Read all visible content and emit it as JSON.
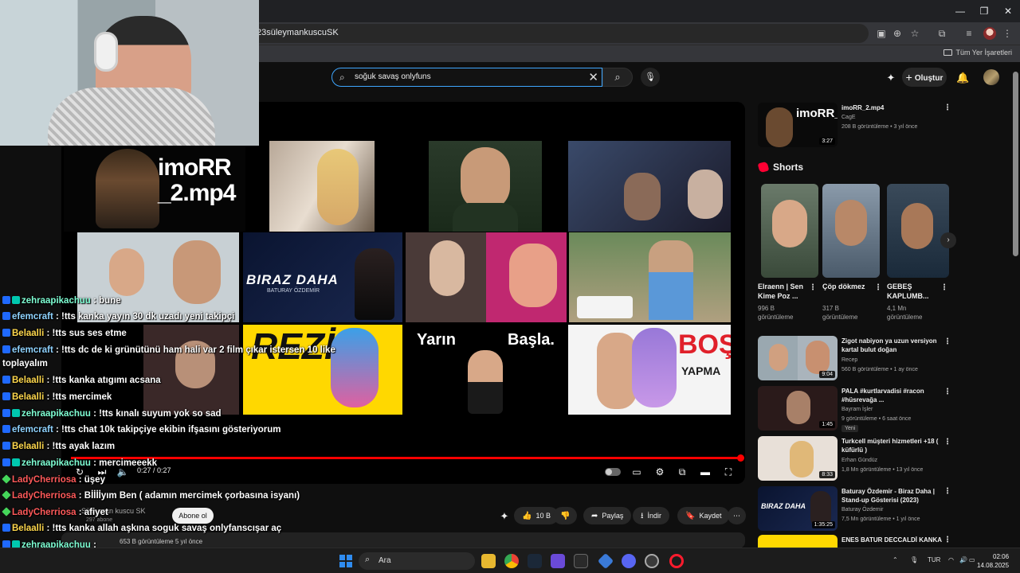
{
  "browser": {
    "url": "23süleymankuscuSK",
    "bookmarks_folder": "Tüm Yer İşaretleri",
    "window_controls": {
      "minimize": "—",
      "restore": "❐",
      "close": "✕"
    }
  },
  "header": {
    "search_query": "soğuk savaş onlyfuns",
    "create_label": "Oluştur"
  },
  "player": {
    "thumb_imorr": "imoRR\n_2.mp4",
    "thumb_biraz": "BIRAZ DAHA",
    "thumb_biraz_sub": "BATURAY ÖZDEMİR",
    "thumb_yarin": "Yarın",
    "thumb_basla": "Başla.",
    "thumb_bos": "BOŞ",
    "thumb_yapma": "YAPMA",
    "thumb_rezil": "REZİL",
    "time": "0:27 / 0:27",
    "progress": 1.0
  },
  "below": {
    "channel": "Süleyman kuscu SK",
    "subs": "297 abone",
    "subscribe": "Abone ol",
    "likes": "10 B",
    "share": "Paylaş",
    "download": "İndir",
    "save": "Kaydet",
    "desc": "653 B görüntüleme  5 yıl önce"
  },
  "sidebar": {
    "top": {
      "title": "imoRR_2.mp4",
      "channel": "CagE",
      "meta": "208 B görüntüleme • 3 yıl önce",
      "duration": "3:27"
    },
    "shorts_label": "Shorts",
    "shorts": [
      {
        "title": "Elraenn | Sen Kime Poz ...",
        "views": "996 B görüntüleme"
      },
      {
        "title": "Çöp dökmez",
        "views": "317 B görüntüleme"
      },
      {
        "title": "GEBEŞ KAPLUMB...",
        "views": "4,1 Mn görüntüleme"
      }
    ],
    "videos": [
      {
        "title": "Zigot nabiyon ya uzun versiyon kartal bulut doğan",
        "channel": "Recep",
        "meta": "560 B görüntüleme • 1 ay önce",
        "duration": "9:04"
      },
      {
        "title": "PALA #kurtlarvadisi #racon #hüsrevağa ...",
        "channel": "Bayram İşler",
        "meta": "9 görüntüleme • 6 saat önce",
        "duration": "1:45",
        "badge": "Yeni"
      },
      {
        "title": "Turkcell müşteri hizmetleri +18 ( küfürlü )",
        "channel": "Erhan Gündüz",
        "meta": "1,8 Mn görüntüleme • 13 yıl önce",
        "duration": "8:33"
      },
      {
        "title": "Baturay Özdemir - Biraz Daha | Stand-up Gösterisi (2023)",
        "channel": "Baturay Özdemir",
        "meta": "7,5 Mn görüntüleme • 1 yıl önce",
        "duration": "1:35:25"
      },
      {
        "title": "ENES BATUR DECCALDİ KANKA",
        "channel": "",
        "meta": "",
        "duration": ""
      }
    ]
  },
  "chat": [
    {
      "user": "zehraapikachuu",
      "msg": ": bune",
      "color": "zehra",
      "badges": [
        "blue",
        "teal"
      ]
    },
    {
      "user": "efemcraft",
      "msg": ": !tts kanka yayın 30 dk uzadı yeni takipçi",
      "color": "efem",
      "badges": [
        "blue"
      ]
    },
    {
      "user": "Belaalli",
      "msg": ": !tts sus ses etme",
      "color": "bela",
      "badges": [
        "blue"
      ]
    },
    {
      "user": "efemcraft",
      "msg": ": !tts dc de ki grünütünü ham hali var 2 film çıkar istersen 10 like",
      "color": "efem",
      "badges": [
        "blue"
      ]
    },
    {
      "user": "",
      "msg": "toplayalım",
      "color": "",
      "badges": []
    },
    {
      "user": "Belaalli",
      "msg": ": !tts kanka atıgımı acsana",
      "color": "bela",
      "badges": [
        "blue"
      ]
    },
    {
      "user": "Belaalli",
      "msg": ": !tts mercimek",
      "color": "bela",
      "badges": [
        "blue"
      ]
    },
    {
      "user": "zehraapikachuu",
      "msg": ": !tts kınalı suyum yok so sad",
      "color": "zehra",
      "badges": [
        "blue",
        "teal"
      ]
    },
    {
      "user": "efemcraft",
      "msg": ": !tts chat 10k takipçiye ekibin ifşasını gösteriyorum",
      "color": "efem",
      "badges": [
        "blue"
      ]
    },
    {
      "user": "Belaalli",
      "msg": ": !tts ayak lazım",
      "color": "bela",
      "badges": [
        "blue"
      ]
    },
    {
      "user": "zehraapikachuu",
      "msg": ": mercimeeekk",
      "color": "zehra",
      "badges": [
        "blue",
        "teal"
      ]
    },
    {
      "user": "LadyCherriosa",
      "msg": ": üşey",
      "color": "lady",
      "badges": [
        "green"
      ]
    },
    {
      "user": "LadyCherriosa",
      "msg": ": Bİİİİyım Ben ( adamın mercimek çorbasına isyanı)",
      "color": "lady",
      "badges": [
        "green"
      ]
    },
    {
      "user": "LadyCherriosa",
      "msg": ": afiyet",
      "color": "lady",
      "badges": [
        "green"
      ]
    },
    {
      "user": "Belaalli",
      "msg": ": !tts kanka allah aşkına soguk savaş onlyfanscışar aç",
      "color": "bela",
      "badges": [
        "blue"
      ]
    },
    {
      "user": "zehraapikachuu",
      "msg": ":",
      "color": "zehra",
      "badges": [
        "blue",
        "teal"
      ]
    }
  ],
  "taskbar": {
    "search": "Ara",
    "lang": "TUR",
    "time": "02:06",
    "date": "14.08.2025"
  },
  "colors": {
    "accent": "#ff0000",
    "link": "#3ea6ff",
    "bg": "#0f0f0f"
  }
}
